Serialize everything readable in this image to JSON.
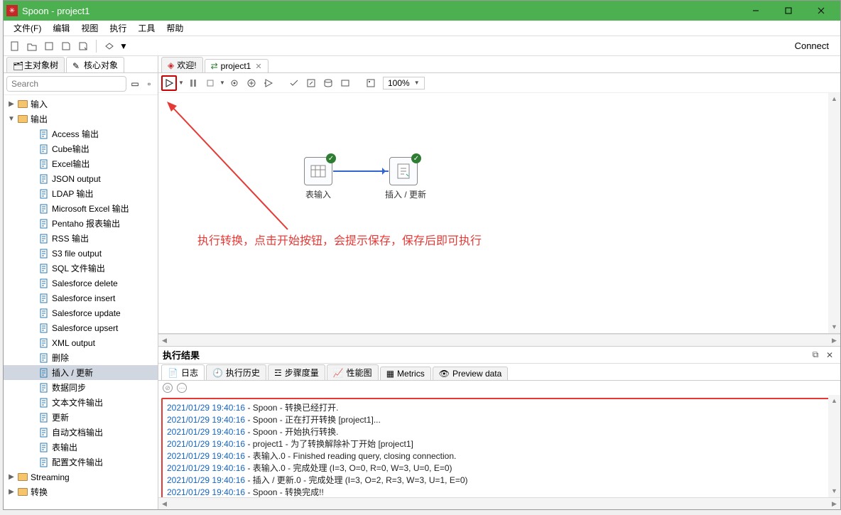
{
  "window": {
    "title": "Spoon - project1"
  },
  "menubar": {
    "file": "文件(F)",
    "edit": "编辑",
    "view": "视图",
    "run": "执行",
    "tools": "工具",
    "help": "帮助"
  },
  "toolbar": {
    "connect": "Connect"
  },
  "sidebar": {
    "tabs": {
      "main": "主对象树",
      "core": "核心对象"
    },
    "search_placeholder": "Search",
    "folders": {
      "input": "输入",
      "output": "输出",
      "streaming": "Streaming",
      "transform": "转换"
    },
    "output_items": [
      "Access 输出",
      "Cube输出",
      "Excel输出",
      "JSON output",
      "LDAP 输出",
      "Microsoft Excel 输出",
      "Pentaho 报表输出",
      "RSS 输出",
      "S3 file output",
      "SQL 文件输出",
      "Salesforce delete",
      "Salesforce insert",
      "Salesforce update",
      "Salesforce upsert",
      "XML output",
      "删除",
      "插入 / 更新",
      "数据同步",
      "文本文件输出",
      "更新",
      "自动文档输出",
      "表输出",
      "配置文件输出"
    ],
    "selected_item": "插入 / 更新"
  },
  "editor": {
    "tabs": {
      "welcome": "欢迎!",
      "project": "project1"
    },
    "zoom": "100%",
    "steps": {
      "table_input": "表输入",
      "insert_update": "插入 / 更新"
    }
  },
  "annotation": "执行转换，点击开始按钮，会提示保存，保存后即可执行",
  "results": {
    "title": "执行结果",
    "tabs": {
      "log": "日志",
      "history": "执行历史",
      "metrics": "步骤度量",
      "perf": "性能图",
      "metrics2": "Metrics",
      "preview": "Preview data"
    },
    "log": [
      {
        "ts": "2021/01/29 19:40:16",
        "msg": " - Spoon - 转换已经打开."
      },
      {
        "ts": "2021/01/29 19:40:16",
        "msg": " - Spoon - 正在打开转换 [project1]..."
      },
      {
        "ts": "2021/01/29 19:40:16",
        "msg": " - Spoon - 开始执行转换."
      },
      {
        "ts": "2021/01/29 19:40:16",
        "msg": " - project1 - 为了转换解除补丁开始  [project1]"
      },
      {
        "ts": "2021/01/29 19:40:16",
        "msg": " - 表输入.0 - Finished reading query, closing connection."
      },
      {
        "ts": "2021/01/29 19:40:16",
        "msg": " - 表输入.0 - 完成处理 (I=3, O=0, R=0, W=3, U=0, E=0)"
      },
      {
        "ts": "2021/01/29 19:40:16",
        "msg": " - 插入 / 更新.0 - 完成处理 (I=3, O=2, R=3, W=3, U=1, E=0)"
      },
      {
        "ts": "2021/01/29 19:40:16",
        "msg": " - Spoon - 转换完成!!"
      }
    ]
  }
}
